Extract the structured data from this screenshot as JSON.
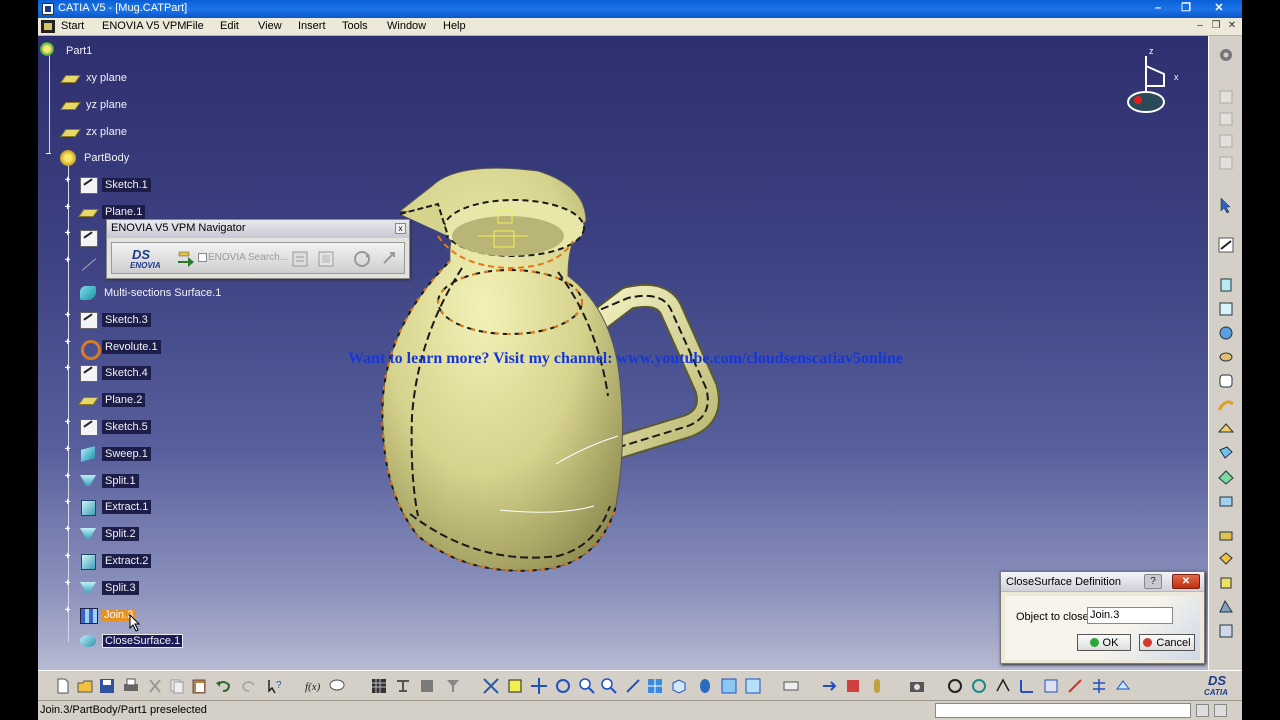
{
  "window": {
    "title": "CATIA V5 - [Mug.CATPart]",
    "minimize_label": "–",
    "restore_label": "❐",
    "close_label": "✕"
  },
  "menu": {
    "items": [
      "Start",
      "ENOVIA V5 VPM",
      "File",
      "Edit",
      "View",
      "Insert",
      "Tools",
      "Window",
      "Help"
    ]
  },
  "tree": {
    "root": "Part1",
    "nodes": [
      {
        "label": "xy plane",
        "icon": "plane-icon"
      },
      {
        "label": "yz plane",
        "icon": "plane-icon"
      },
      {
        "label": "zx plane",
        "icon": "plane-icon"
      },
      {
        "label": "PartBody",
        "icon": "partbody-icon"
      },
      {
        "label": "Sketch.1",
        "icon": "sketch-icon"
      },
      {
        "label": "Plane.1",
        "icon": "plane-icon"
      },
      {
        "label": "",
        "icon": "sketch-icon"
      },
      {
        "label": "",
        "icon": "line-icon"
      },
      {
        "label": "Multi-sections Surface.1",
        "icon": "multi-section-surface-icon"
      },
      {
        "label": "Sketch.3",
        "icon": "sketch-icon"
      },
      {
        "label": "Revolute.1",
        "icon": "revolute-icon"
      },
      {
        "label": "Sketch.4",
        "icon": "sketch-icon"
      },
      {
        "label": "Plane.2",
        "icon": "plane-icon"
      },
      {
        "label": "Sketch.5",
        "icon": "sketch-icon"
      },
      {
        "label": "Sweep.1",
        "icon": "sweep-icon"
      },
      {
        "label": "Split.1",
        "icon": "split-icon"
      },
      {
        "label": "Extract.1",
        "icon": "extract-icon"
      },
      {
        "label": "Split.2",
        "icon": "split-icon"
      },
      {
        "label": "Extract.2",
        "icon": "extract-icon"
      },
      {
        "label": "Split.3",
        "icon": "split-icon"
      },
      {
        "label": "Join.3",
        "icon": "join-icon"
      },
      {
        "label": "CloseSurface.1",
        "icon": "close-surface-icon"
      }
    ]
  },
  "navigator": {
    "title": "ENOVIA V5 VPM Navigator",
    "close_label": "x",
    "logo_ds": "DS",
    "logo_text": "ENOVIA",
    "search_placeholder": "ENOVIA Search..."
  },
  "viewport": {
    "watermark": "Want to learn more? Visit my channel: www.youtube.com/cloudsenscatiav5online",
    "compass_z": "z",
    "compass_x": "x"
  },
  "dialog": {
    "title": "CloseSurface Definition",
    "help_label": "?",
    "close_label": "✕",
    "object_label": "Object to close:",
    "object_value": "Join.3",
    "ok_label": "OK",
    "cancel_label": "Cancel"
  },
  "bottom_toolbar": {
    "catia_ds": "DS",
    "catia_text": "CATIA"
  },
  "status": {
    "text": "Join.3/PartBody/Part1 preselected"
  },
  "colors": {
    "viewport_top": "#2e2f6e",
    "viewport_bottom": "#b7bad2",
    "model_fill": "#d9d590",
    "edge_dash": "#e07a1a",
    "selection": "#e89020",
    "watermark": "#1537d6"
  }
}
